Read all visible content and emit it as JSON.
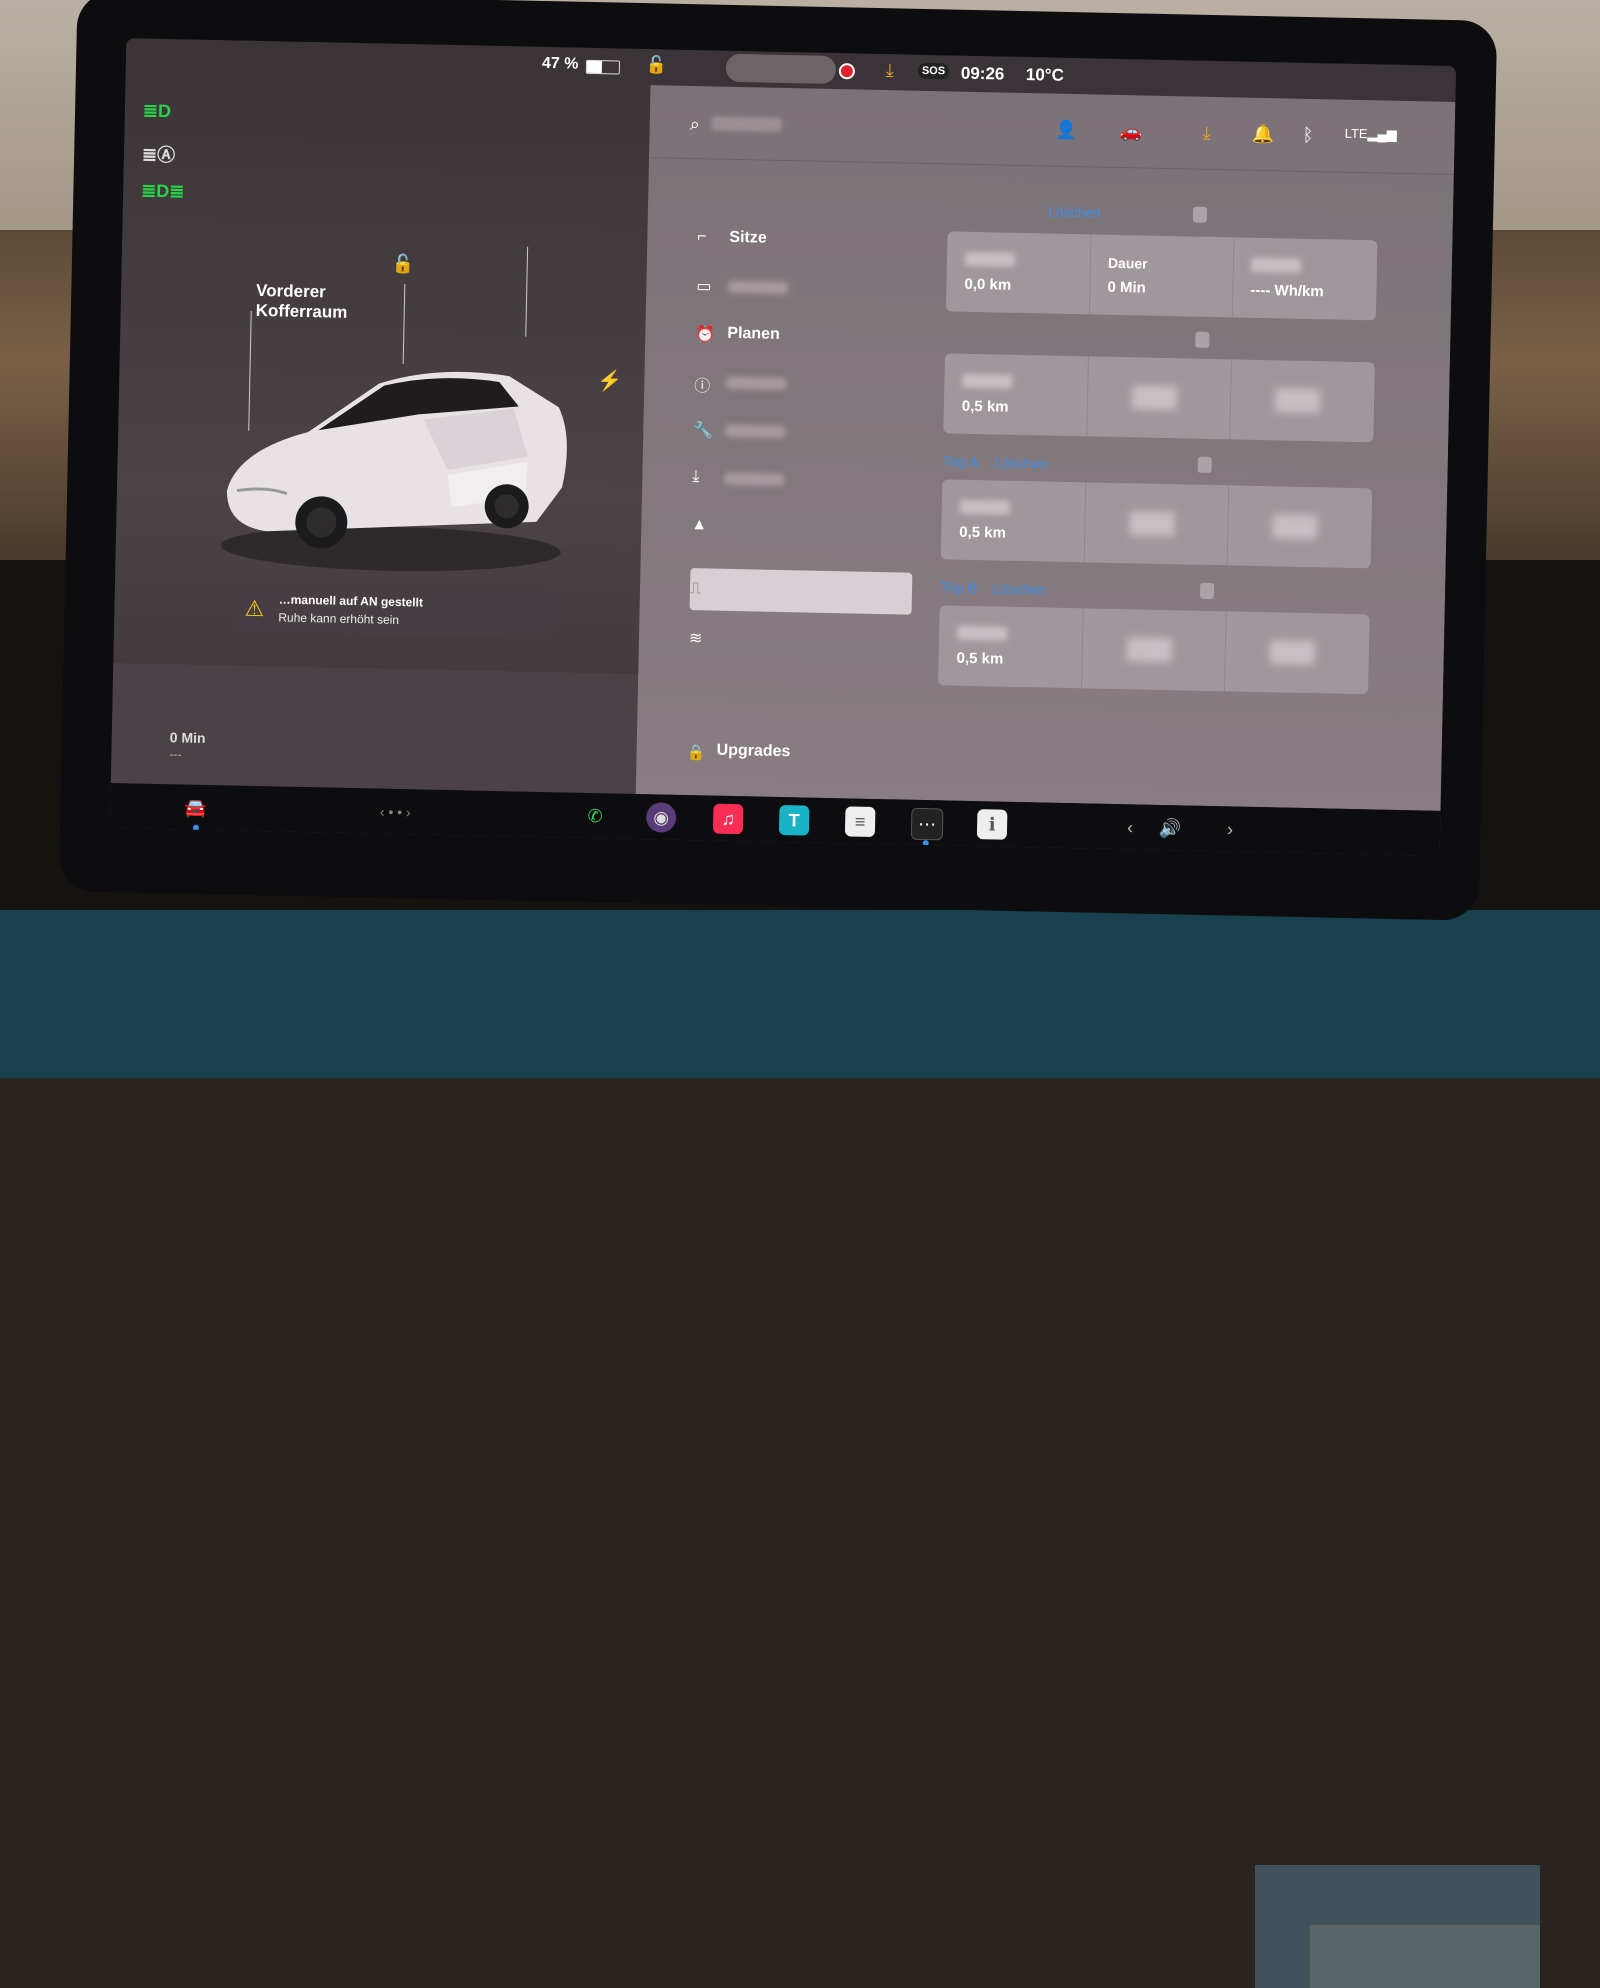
{
  "status": {
    "battery_percent": "47 %",
    "battery_level": 0.47,
    "time": "09:26",
    "temperature": "10°C",
    "sos": "SOS"
  },
  "car": {
    "frunk_label": "Vorderer\nKofferraum",
    "warning_line1": "…manuell auf AN gestellt",
    "warning_line2": "Ruhe kann erhöht sein",
    "range_value": "0 Min",
    "range_sub": "---"
  },
  "nav": {
    "items": [
      {
        "label": "Sitze",
        "icon": "seat-icon"
      },
      {
        "label": "",
        "icon": "display-icon"
      },
      {
        "label": "Planen",
        "icon": "clock-icon"
      },
      {
        "label": "",
        "icon": "safety-icon"
      },
      {
        "label": "",
        "icon": "wrench-icon"
      },
      {
        "label": "",
        "icon": "download-icon"
      },
      {
        "label": "",
        "icon": "navigation-icon"
      },
      {
        "label": "",
        "icon": "trips-icon"
      },
      {
        "label": "",
        "icon": "wifi-icon"
      }
    ],
    "upgrades_label": "Upgrades"
  },
  "trips": {
    "section1": {
      "clear_label": "Löschen",
      "distance": "0,0 km",
      "duration_label": "Dauer",
      "duration": "0 Min",
      "efficiency": "---- Wh/km"
    },
    "section2": {
      "distance": "0,5 km"
    },
    "section3": {
      "title": "Trip A",
      "clear_label": "Löschen",
      "distance": "0,5 km"
    },
    "section4": {
      "title": "Trip B",
      "clear_label": "Löschen",
      "distance": "0,5 km"
    }
  },
  "colors": {
    "accent": "#3b8fe8",
    "headlight_green": "#28d24a",
    "warning": "#f5c518",
    "record": "#e0212a"
  }
}
